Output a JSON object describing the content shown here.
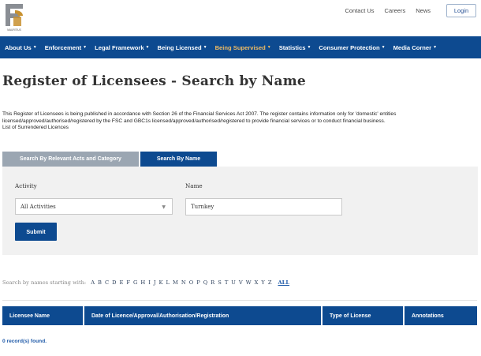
{
  "header": {
    "logo_icon": "fsc-logo-icon",
    "logo_text": "MAURITIUS",
    "top_links": [
      "Contact Us",
      "Careers",
      "News"
    ],
    "login_label": "Login"
  },
  "nav": {
    "items": [
      {
        "label": "About Us"
      },
      {
        "label": "Enforcement"
      },
      {
        "label": "Legal Framework"
      },
      {
        "label": "Being Licensed"
      },
      {
        "label": "Being Supervised"
      },
      {
        "label": "Statistics"
      },
      {
        "label": "Consumer Protection"
      },
      {
        "label": "Media Corner"
      }
    ],
    "active_index": 4,
    "background_color": "#0d4a90",
    "active_color": "#f2bd63"
  },
  "page": {
    "title": "Register of Licensees - Search by Name",
    "intro_line1": "This Register of Licensees is being published in accordance with Section 26 of the Financial Services Act 2007. The register contains information only for 'domestic' entities",
    "intro_line2": "licensed/approved/authorised/registered by the FSC and GBC1s licensed/approved/authorised/registered to provide financial services or to conduct financial business.",
    "intro_line3": "List of Surrendered Licences"
  },
  "tabs": [
    {
      "label": "Search By Relevant Acts and Category",
      "active": false
    },
    {
      "label": "Search By Name",
      "active": true
    }
  ],
  "search": {
    "activity_label": "Activity",
    "activity_value": "All Activities",
    "name_label": "Name",
    "name_value": "Turnkey",
    "submit_label": "Submit"
  },
  "alphabet": {
    "label": "Search by names starting with:",
    "letters": [
      "A",
      "B",
      "C",
      "D",
      "E",
      "F",
      "G",
      "H",
      "I",
      "J",
      "K",
      "L",
      "M",
      "N",
      "O",
      "P",
      "Q",
      "R",
      "S",
      "T",
      "U",
      "V",
      "W",
      "X",
      "Y",
      "Z"
    ],
    "all_label": "ALL"
  },
  "table": {
    "columns": [
      "Licensee Name",
      "Date of Licence/Approval/Authorisation/Registration",
      "Type of License",
      "Annotations"
    ],
    "rows": []
  },
  "results": {
    "records_text": "0 record(s) found."
  }
}
